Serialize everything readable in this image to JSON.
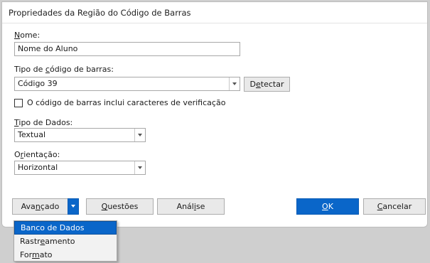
{
  "dialog": {
    "title": "Propriedades da Região do Código de Barras",
    "name_label": {
      "pre": "",
      "key": "N",
      "post": "ome:"
    },
    "name_value": "Nome do Aluno",
    "barcode_type_label": {
      "pre": "Tipo de ",
      "key": "c",
      "post": "ódigo de barras:"
    },
    "barcode_type_value": "Código 39",
    "detect_button": {
      "pre": "D",
      "key": "e",
      "post": "tectar"
    },
    "checksum_checkbox": {
      "checked": false,
      "label": "O código de barras inclui caracteres de verificação"
    },
    "data_type_label": {
      "pre": "",
      "key": "T",
      "post": "ipo de Dados:"
    },
    "data_type_value": "Textual",
    "orientation_label": {
      "pre": "O",
      "key": "r",
      "post": "ientação:"
    },
    "orientation_value": "Horizontal"
  },
  "buttons": {
    "advanced": {
      "pre": "Ava",
      "key": "n",
      "post": "çado"
    },
    "questions": {
      "pre": "",
      "key": "Q",
      "post": "uestões"
    },
    "analysis": {
      "pre": "Anál",
      "key": "i",
      "post": "se"
    },
    "ok": {
      "pre": "",
      "key": "O",
      "post": "K"
    },
    "cancel": {
      "pre": "",
      "key": "C",
      "post": "ancelar"
    }
  },
  "menu": {
    "items": [
      {
        "pre": "Banco de Dados",
        "key": "",
        "post": "",
        "selected": true
      },
      {
        "pre": "Rastr",
        "key": "e",
        "post": "amento",
        "selected": false
      },
      {
        "pre": "For",
        "key": "m",
        "post": "ato",
        "selected": false
      }
    ]
  },
  "colors": {
    "accent": "#0a66c9",
    "dialog_bg": "#ffffff",
    "backdrop": "#cfcfcf"
  }
}
